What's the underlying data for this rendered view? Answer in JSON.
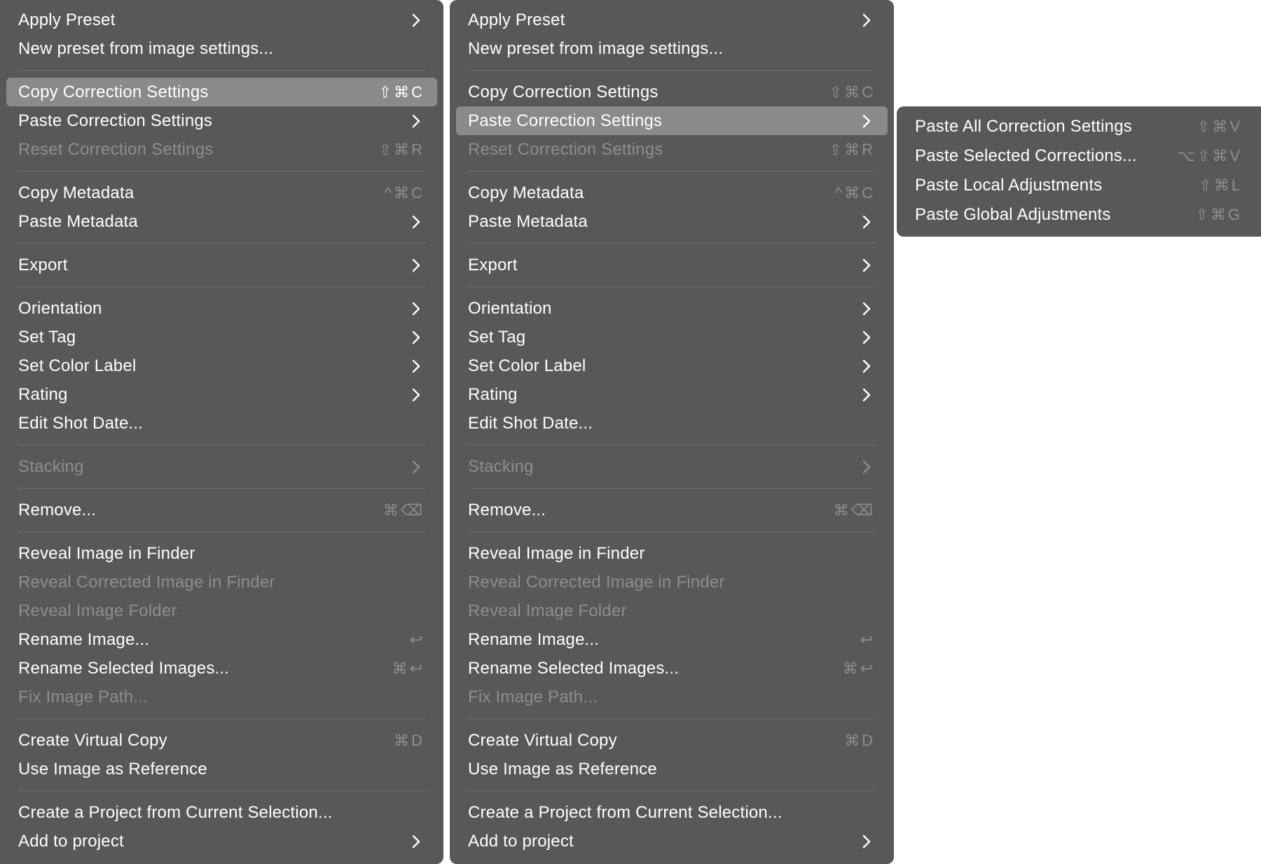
{
  "menu": {
    "items": [
      {
        "type": "item",
        "label": "Apply Preset",
        "submenu": true
      },
      {
        "type": "item",
        "label": "New preset from image settings..."
      },
      {
        "type": "sep"
      },
      {
        "type": "item",
        "label": "Copy Correction Settings",
        "shortcut": "⇧⌘C"
      },
      {
        "type": "item",
        "label": "Paste Correction Settings",
        "submenu": true
      },
      {
        "type": "item",
        "label": "Reset Correction Settings",
        "shortcut": "⇧⌘R",
        "disabled": true
      },
      {
        "type": "sep"
      },
      {
        "type": "item",
        "label": "Copy Metadata",
        "shortcut": "^⌘C"
      },
      {
        "type": "item",
        "label": "Paste Metadata",
        "submenu": true
      },
      {
        "type": "sep"
      },
      {
        "type": "item",
        "label": "Export",
        "submenu": true
      },
      {
        "type": "sep"
      },
      {
        "type": "item",
        "label": "Orientation",
        "submenu": true
      },
      {
        "type": "item",
        "label": "Set Tag",
        "submenu": true
      },
      {
        "type": "item",
        "label": "Set Color Label",
        "submenu": true
      },
      {
        "type": "item",
        "label": "Rating",
        "submenu": true
      },
      {
        "type": "item",
        "label": "Edit Shot Date..."
      },
      {
        "type": "sep"
      },
      {
        "type": "item",
        "label": "Stacking",
        "submenu": true,
        "disabled": true
      },
      {
        "type": "sep"
      },
      {
        "type": "item",
        "label": "Remove...",
        "shortcut": "⌘⌫"
      },
      {
        "type": "sep"
      },
      {
        "type": "item",
        "label": "Reveal Image in Finder"
      },
      {
        "type": "item",
        "label": "Reveal Corrected Image in Finder",
        "disabled": true
      },
      {
        "type": "item",
        "label": "Reveal Image Folder",
        "disabled": true
      },
      {
        "type": "item",
        "label": "Rename Image...",
        "shortcut": "↩"
      },
      {
        "type": "item",
        "label": "Rename Selected Images...",
        "shortcut": "⌘↩"
      },
      {
        "type": "item",
        "label": "Fix Image Path...",
        "disabled": true
      },
      {
        "type": "sep"
      },
      {
        "type": "item",
        "label": "Create Virtual Copy",
        "shortcut": "⌘D"
      },
      {
        "type": "item",
        "label": "Use Image as Reference"
      },
      {
        "type": "sep"
      },
      {
        "type": "item",
        "label": "Create a Project from Current Selection..."
      },
      {
        "type": "item",
        "label": "Add to project",
        "submenu": true
      }
    ]
  },
  "left_menu": {
    "highlighted": "Copy Correction Settings"
  },
  "right_menu": {
    "highlighted": "Paste Correction Settings"
  },
  "submenu": {
    "items": [
      {
        "type": "item",
        "label": "Paste All Correction Settings",
        "shortcut": "⇧⌘V"
      },
      {
        "type": "item",
        "label": "Paste Selected Corrections...",
        "shortcut": "⌥⇧⌘V"
      },
      {
        "type": "item",
        "label": "Paste Local Adjustments",
        "shortcut": "⇧⌘L"
      },
      {
        "type": "item",
        "label": "Paste Global Adjustments",
        "shortcut": "⇧⌘G"
      }
    ]
  },
  "colors": {
    "menu_bg": "#585858",
    "highlight": "#8a8a8a",
    "text": "#ffffff",
    "disabled_text": "#8e8e8e",
    "separator": "#707070"
  }
}
